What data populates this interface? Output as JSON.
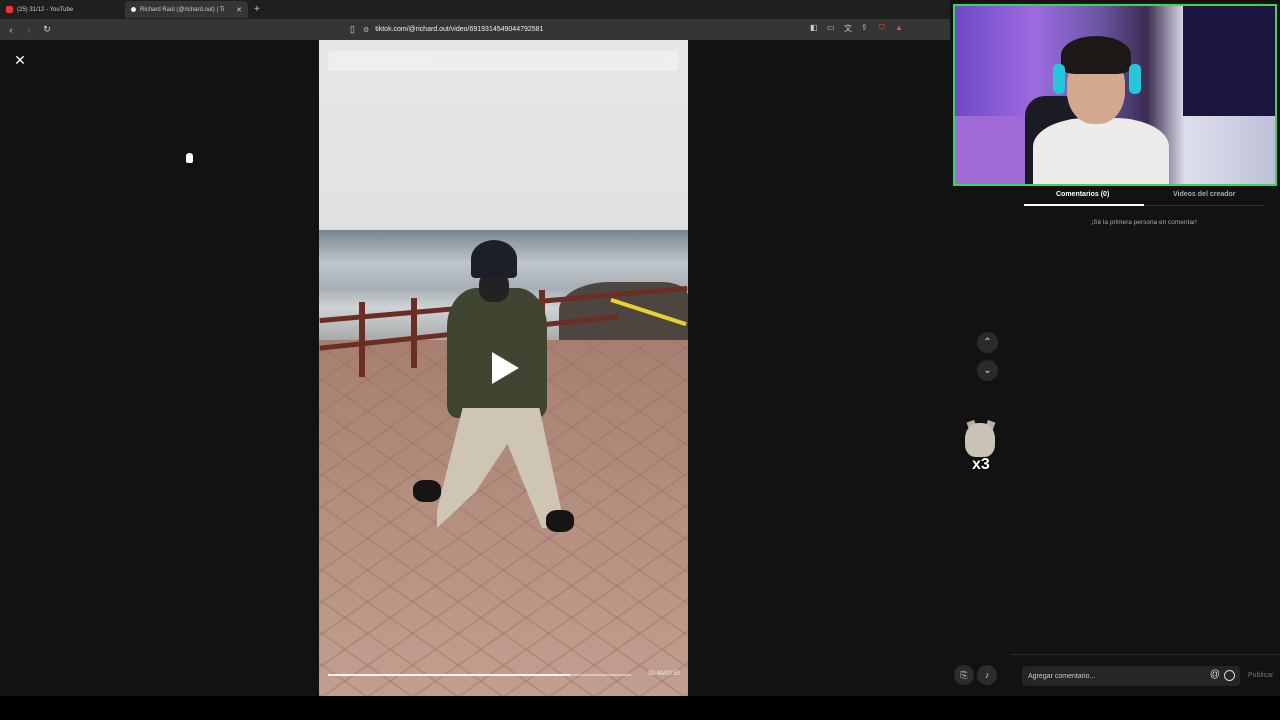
{
  "browser": {
    "tabs": [
      {
        "label": "(25) 31/12 - YouTube"
      },
      {
        "label": "Richard Raúl (@richard.out) | Ti"
      }
    ],
    "new_tab": "+",
    "url": "tiktok.com/@richard.out/video/6919314549044792581"
  },
  "video": {
    "search_placeholder": "Buscar contenido relacionado",
    "time": "00:40/00:50",
    "progress": 0.8
  },
  "panel": {
    "tab_comments": "Comentarios (0)",
    "tab_creator": "Videos del creador",
    "empty_message": "¡Sé la primera persona en comentar!",
    "comment_placeholder": "Agregar comentario...",
    "publish": "Publicar"
  },
  "sticker": {
    "label": "x3"
  }
}
